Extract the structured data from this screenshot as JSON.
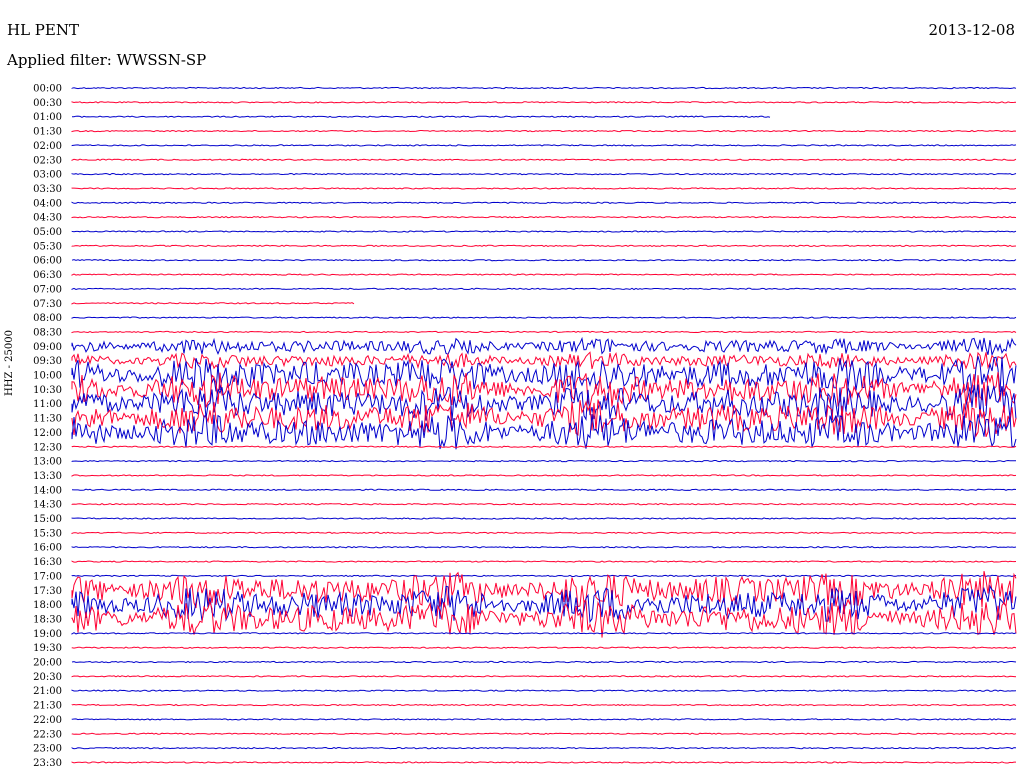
{
  "header": {
    "station": "HL PENT",
    "date": "2013-12-08",
    "filter": "Applied filter: WWSSN-SP"
  },
  "channel_label": "HHZ - 25000",
  "colors": {
    "blue": "#0000cc",
    "red": "#ff0033"
  },
  "chart_data": {
    "type": "line",
    "title": "HL PENT",
    "x_unit": "minutes within 30-minute trace row",
    "x_range": [
      0,
      30
    ],
    "row_labels": [
      "00:00",
      "00:30",
      "01:00",
      "01:30",
      "02:00",
      "02:30",
      "03:00",
      "03:30",
      "04:00",
      "04:30",
      "05:00",
      "05:30",
      "06:00",
      "06:30",
      "07:00",
      "07:30",
      "08:00",
      "08:30",
      "09:00",
      "09:30",
      "10:00",
      "10:30",
      "11:00",
      "11:30",
      "12:00",
      "12:30",
      "13:00",
      "13:30",
      "14:00",
      "14:30",
      "15:00",
      "15:30",
      "16:00",
      "16:30",
      "17:00",
      "17:30",
      "18:00",
      "18:30",
      "19:00",
      "19:30",
      "20:00",
      "20:30",
      "21:00",
      "21:30",
      "22:00",
      "22:30",
      "23:00",
      "23:30"
    ],
    "row_extent_fraction": [
      1,
      1,
      0.74,
      1,
      1,
      1,
      1,
      1,
      1,
      1,
      1,
      1,
      1,
      1,
      1,
      0.3,
      1,
      1,
      1,
      1,
      1,
      1,
      1,
      1,
      1,
      1,
      1,
      1,
      1,
      1,
      1,
      1,
      1,
      1,
      1,
      1,
      1,
      1,
      1,
      1,
      1,
      1,
      1,
      1,
      1,
      1,
      1,
      1
    ],
    "row_colors": "alternating blue/red starting with blue",
    "activity_windows": [
      {
        "label": "10:00–12:30 strong tremor",
        "rows": [
          "10:00",
          "10:30",
          "11:00",
          "11:30",
          "12:00"
        ],
        "level": 0.9
      },
      {
        "label": "17:30–19:00 strong tremor",
        "rows": [
          "17:30",
          "18:00",
          "18:30"
        ],
        "level": 0.9
      },
      {
        "label": "09:00–09:30 moderate activity",
        "rows": [
          "09:00",
          "09:30"
        ],
        "level": 0.4
      }
    ]
  }
}
